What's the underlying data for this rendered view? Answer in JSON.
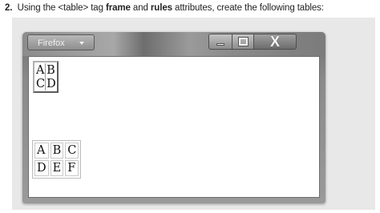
{
  "question": {
    "number": "2.",
    "text_pre": "Using the",
    "tag": "<table>",
    "text_tag": "tag",
    "attr1": "frame",
    "text_and": "and",
    "attr2": "rules",
    "text_post": "attributes, create the following tables:"
  },
  "browser": {
    "app_button": "Firefox",
    "controls": {
      "minimize": "minimize",
      "maximize": "maximize",
      "close": "X"
    }
  },
  "table1": {
    "rows": [
      [
        "A",
        "B"
      ],
      [
        "C",
        "D"
      ]
    ]
  },
  "table2": {
    "rows": [
      [
        "A",
        "B",
        "C"
      ],
      [
        "D",
        "E",
        "F"
      ]
    ]
  }
}
